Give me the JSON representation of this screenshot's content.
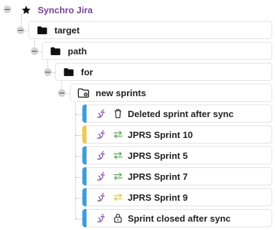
{
  "tree": {
    "root": {
      "label": "Synchro Jira",
      "icon": "star-icon"
    },
    "folders": [
      {
        "label": "target",
        "icon": "folder-icon"
      },
      {
        "label": "path",
        "icon": "folder-icon"
      },
      {
        "label": "for",
        "icon": "folder-icon"
      },
      {
        "label": "new sprints",
        "icon": "folder-settings-icon"
      }
    ],
    "sprints": [
      {
        "label": "Deleted sprint after sync",
        "status_icon": "trash-icon",
        "accent": "#3a9fe0",
        "status_color": "#222222"
      },
      {
        "label": "JPRS Sprint 10",
        "status_icon": "sync-arrows-icon",
        "accent": "#f2c94c",
        "status_color": "#3aaa35"
      },
      {
        "label": "JPRS Sprint 5",
        "status_icon": "sync-arrows-icon",
        "accent": "#3a9fe0",
        "status_color": "#3aaa35"
      },
      {
        "label": "JPRS Sprint 7",
        "status_icon": "sync-arrows-icon",
        "accent": "#3a9fe0",
        "status_color": "#3aaa35"
      },
      {
        "label": "JPRS Sprint 9",
        "status_icon": "sync-arrows-icon",
        "accent": "#3a9fe0",
        "status_color": "#e8c21e"
      },
      {
        "label": "Sprint closed after sync",
        "status_icon": "lock-icon",
        "accent": "#3a9fe0",
        "status_color": "#222222"
      }
    ]
  },
  "colors": {
    "sprint_icon": "#7b3ea5",
    "root_label": "#7b3ea5"
  }
}
